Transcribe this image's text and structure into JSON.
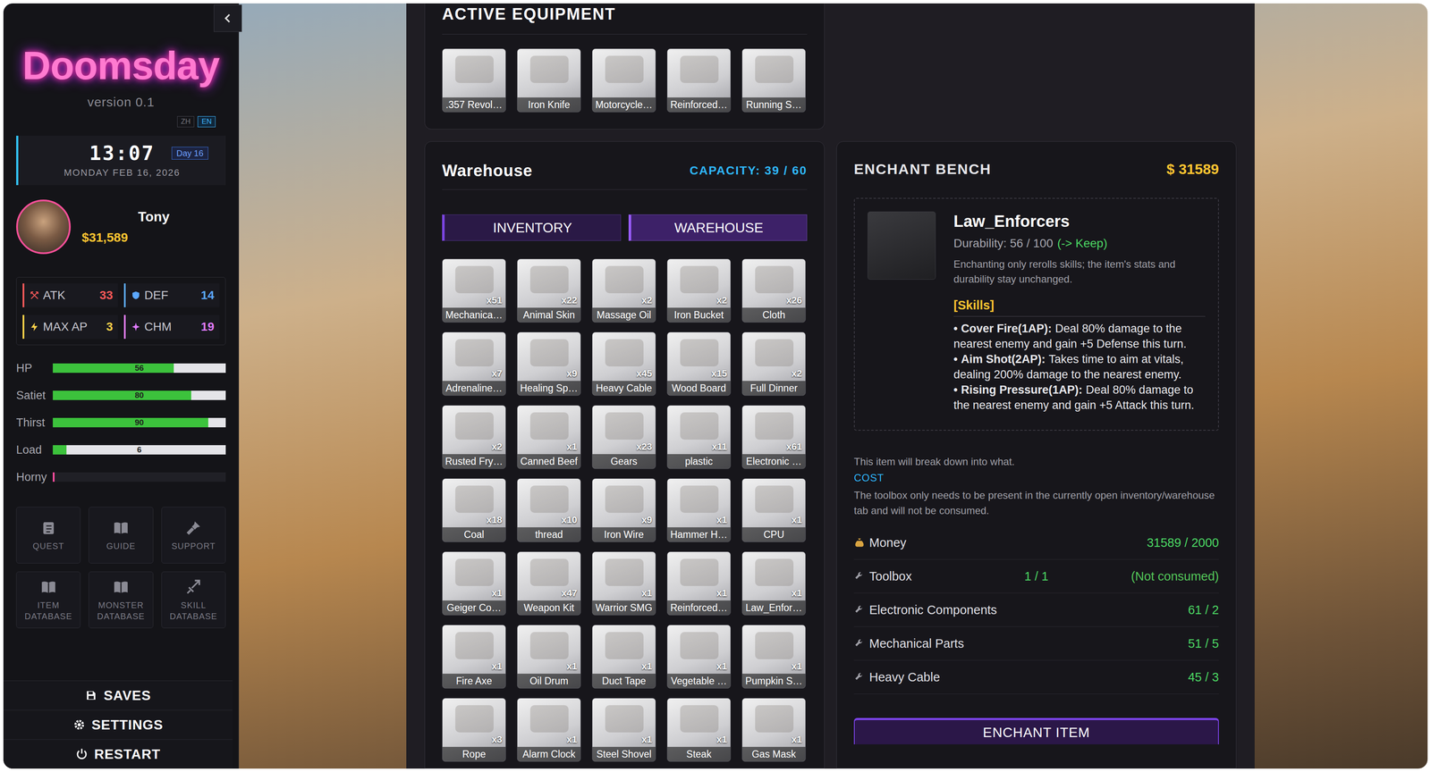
{
  "sidebar": {
    "logo": "Doomsday",
    "version": "version 0.1",
    "languages": [
      {
        "label": "ZH",
        "selected": false
      },
      {
        "label": "EN",
        "selected": true
      }
    ],
    "clock": {
      "time": "13:07",
      "day": "Day 16",
      "date": "MONDAY FEB 16, 2026"
    },
    "player": {
      "name": "Tony",
      "money": "$31,589"
    },
    "stats": [
      {
        "label": "ATK",
        "value": "33",
        "color": "#ff5a5a"
      },
      {
        "label": "DEF",
        "value": "14",
        "color": "#5ca8ff"
      },
      {
        "label": "MAX AP",
        "value": "3",
        "color": "#ffd24a"
      },
      {
        "label": "CHM",
        "value": "19",
        "color": "#e07bff"
      }
    ],
    "bars": [
      {
        "label": "HP",
        "value": "56",
        "level": 0.7,
        "color": "#3cc23c",
        "kind": "meter"
      },
      {
        "label": "Satiet",
        "value": "80",
        "level": 0.8,
        "color": "#3cc23c",
        "kind": "meter"
      },
      {
        "label": "Thirst",
        "value": "90",
        "level": 0.9,
        "color": "#3cc23c",
        "kind": "meter"
      },
      {
        "label": "Load",
        "value": "6",
        "level": 0.08,
        "color": "#3cc23c",
        "kind": "meter"
      },
      {
        "label": "Horny",
        "level": 0.01,
        "color": "#ff4fa3",
        "kind": "gauge"
      }
    ],
    "shortcuts": [
      "QUEST",
      "GUIDE",
      "SUPPORT",
      "ITEM DATABASE",
      "MONSTER DATABASE",
      "SKILL DATABASE"
    ],
    "actions": [
      "SAVES",
      "SETTINGS",
      "RESTART"
    ]
  },
  "equipment": {
    "title": "ACTIVE EQUIPMENT",
    "items": [
      ".357 Revol…",
      "Iron Knife",
      "Motorcycle…",
      "Reinforced…",
      "Running S…"
    ]
  },
  "warehouse": {
    "title": "Warehouse",
    "capacity": "CAPACITY: 39 / 60",
    "tabs": [
      {
        "label": "INVENTORY",
        "selected": false
      },
      {
        "label": "WAREHOUSE",
        "selected": true
      }
    ],
    "items": [
      {
        "name": "Mechanica…",
        "count": "x51"
      },
      {
        "name": "Animal Skin",
        "count": "x22"
      },
      {
        "name": "Massage Oil",
        "count": "x2"
      },
      {
        "name": "Iron Bucket",
        "count": "x2"
      },
      {
        "name": "Cloth",
        "count": "x26"
      },
      {
        "name": "Adrenaline…",
        "count": "x7"
      },
      {
        "name": "Healing Sp…",
        "count": "x9"
      },
      {
        "name": "Heavy Cable",
        "count": "x45"
      },
      {
        "name": "Wood Board",
        "count": "x15"
      },
      {
        "name": "Full Dinner",
        "count": "x2"
      },
      {
        "name": "Rusted Fry…",
        "count": "x2"
      },
      {
        "name": "Canned Beef",
        "count": "x1"
      },
      {
        "name": "Gears",
        "count": "x23"
      },
      {
        "name": "plastic",
        "count": "x11"
      },
      {
        "name": "Electronic …",
        "count": "x61"
      },
      {
        "name": "Coal",
        "count": "x18"
      },
      {
        "name": "thread",
        "count": "x10"
      },
      {
        "name": "Iron Wire",
        "count": "x9"
      },
      {
        "name": "Hammer H…",
        "count": "x1"
      },
      {
        "name": "CPU",
        "count": "x1"
      },
      {
        "name": "Geiger Co…",
        "count": "x1"
      },
      {
        "name": "Weapon Kit",
        "count": "x47"
      },
      {
        "name": "Warrior SMG",
        "count": "x1"
      },
      {
        "name": "Reinforced…",
        "count": "x1"
      },
      {
        "name": "Law_Enfor…",
        "count": "x1"
      },
      {
        "name": "Fire Axe",
        "count": "x1"
      },
      {
        "name": "Oil Drum",
        "count": "x1"
      },
      {
        "name": "Duct Tape",
        "count": "x1"
      },
      {
        "name": "Vegetable …",
        "count": "x1"
      },
      {
        "name": "Pumpkin S…",
        "count": "x1"
      },
      {
        "name": "Rope",
        "count": "x3"
      },
      {
        "name": "Alarm Clock",
        "count": "x1"
      },
      {
        "name": "Steel Shovel",
        "count": "x1"
      },
      {
        "name": "Steak",
        "count": "x1"
      },
      {
        "name": "Gas Mask",
        "count": "x1"
      }
    ]
  },
  "enchant": {
    "title": "ENCHANT BENCH",
    "money": "$ 31589",
    "item": {
      "name": "Law_Enforcers",
      "durability": "Durability: 56 / 100",
      "keep": "(-> Keep)",
      "description": "Enchanting only rerolls skills; the item's stats and durability stay unchanged.",
      "skills_title": "[Skills]",
      "bullet": "•",
      "skills": [
        {
          "name": "Cover Fire(1AP):",
          "description": "Deal 80% damage to the nearest enemy and gain +5 Defense this turn."
        },
        {
          "name": "Aim Shot(2AP):",
          "description": "Takes time to aim at vitals, dealing 200% damage to the nearest enemy."
        },
        {
          "name": "Rising Pressure(1AP):",
          "description": "Deal 80% damage to the nearest enemy and gain +5 Attack this turn."
        }
      ]
    },
    "breakdown": "This item will break down into what.",
    "cost_title": "COST",
    "note": "The toolbox only needs to be present in the currently open inventory/warehouse tab and will not be consumed.",
    "costs": [
      {
        "label": "Money",
        "value": "31589 / 2000",
        "kind": "money"
      },
      {
        "label": "Toolbox",
        "value": "1 / 1",
        "note": "(Not consumed)",
        "kind": "material"
      },
      {
        "label": "Electronic Components",
        "value": "61 / 2",
        "kind": "material"
      },
      {
        "label": "Mechanical Parts",
        "value": "51 / 5",
        "kind": "material"
      },
      {
        "label": "Heavy Cable",
        "value": "45 / 3",
        "kind": "material"
      }
    ],
    "button": "ENCHANT ITEM"
  }
}
